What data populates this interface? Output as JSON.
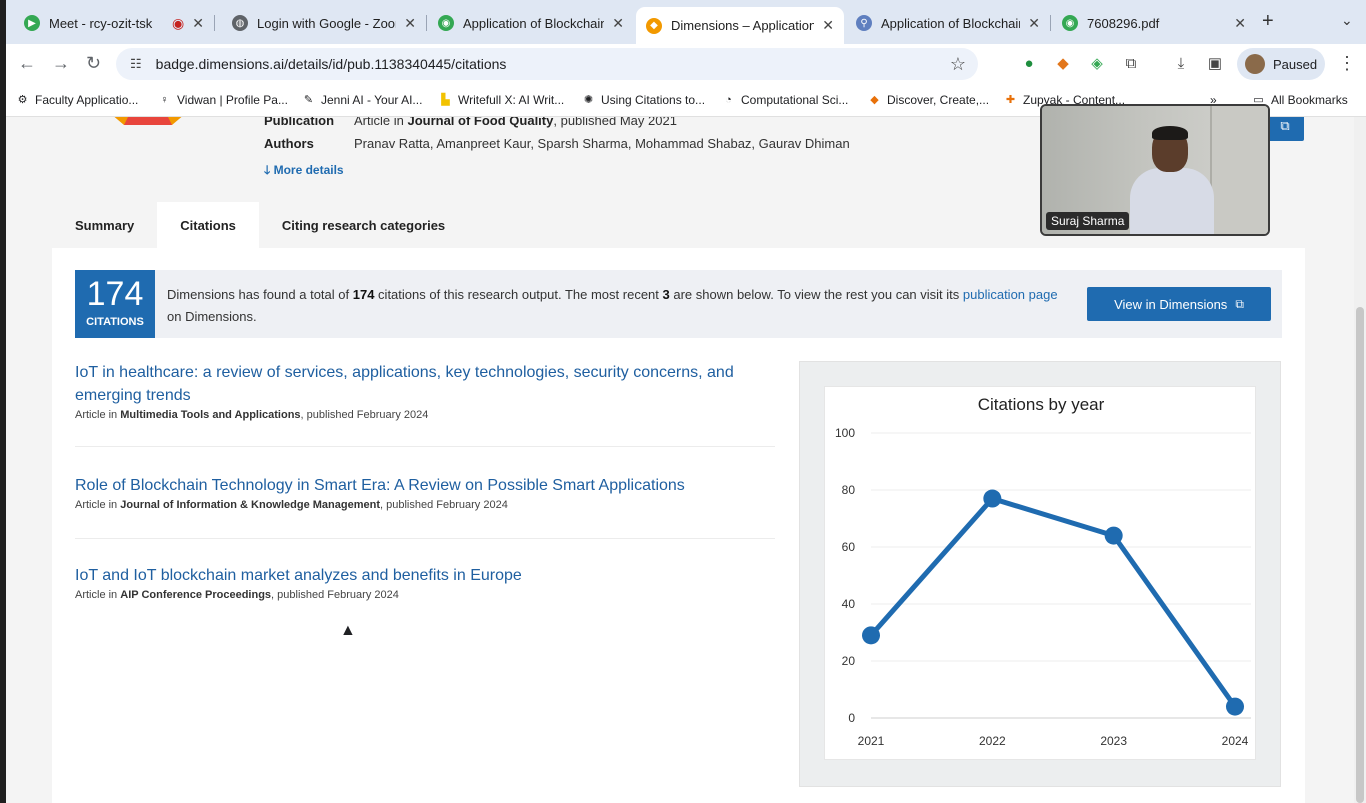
{
  "browser": {
    "tabs": [
      {
        "title": "Meet - rcy-ozit-tsk",
        "icon": "google-meet-icon",
        "active": false,
        "recording": true
      },
      {
        "title": "Login with Google - Zoom",
        "icon": "globe-icon",
        "active": false
      },
      {
        "title": "Application of Blockchain",
        "icon": "eye-icon",
        "active": false
      },
      {
        "title": "Dimensions – Application",
        "icon": "dimensions-icon",
        "active": true
      },
      {
        "title": "Application of Blockchain",
        "icon": "link-icon",
        "active": false
      },
      {
        "title": "7608296.pdf",
        "icon": "eye-icon",
        "active": false
      }
    ],
    "url": "badge.dimensions.ai/details/id/pub.1138340445/citations",
    "profile_label": "Paused",
    "bookmarks": [
      "Faculty Applicatio...",
      "Vidwan | Profile Pa...",
      "Jenni AI - Your AI...",
      "Writefull X: AI Writ...",
      "Using Citations to...",
      "Computational Sci...",
      "Discover, Create,...",
      "Zupyak - Content..."
    ],
    "all_bookmarks": "All Bookmarks"
  },
  "details": {
    "publication_label": "Publication",
    "publication_prefix": "Article in ",
    "journal": "Journal of Food Quality",
    "publication_suffix": ", published May 2021",
    "authors_label": "Authors",
    "authors": "Pranav Ratta, Amanpreet Kaur, Sparsh Sharma, Mohammad Shabaz, Gaurav Dhiman",
    "more_details": "More details"
  },
  "page_tabs": [
    "Summary",
    "Citations",
    "Citing research categories"
  ],
  "active_tab": "Citations",
  "notice": {
    "count": "174",
    "count_label": "CITATIONS",
    "msg_1": "Dimensions has found a total of ",
    "msg_count": "174",
    "msg_2": " citations of this research output. The most recent ",
    "msg_recent": "3",
    "msg_3": " are shown below. To view the rest you can visit its ",
    "msg_link": "publication page",
    "msg_4": " on Dimensions.",
    "button": "View in Dimensions"
  },
  "citations": [
    {
      "title": "IoT in healthcare: a review of services, applications, key technologies, security concerns, and emerging trends",
      "prefix": "Article in ",
      "journal": "Multimedia Tools and Applications",
      "suffix": ", published February 2024"
    },
    {
      "title": "Role of Blockchain Technology in Smart Era: A Review on Possible Smart Applications",
      "prefix": "Article in ",
      "journal": "Journal of Information & Knowledge Management",
      "suffix": ", published February 2024"
    },
    {
      "title": "IoT and IoT blockchain market analyzes and benefits in Europe",
      "prefix": "Article in ",
      "journal": "AIP Conference Proceedings",
      "suffix": ", published February 2024"
    }
  ],
  "video": {
    "participant": "Suraj Sharma"
  },
  "colors": {
    "accent": "#1f6bb0",
    "line": "#1f6bb0"
  },
  "chart_data": {
    "type": "line",
    "title": "Citations by year",
    "categories": [
      "2021",
      "2022",
      "2023",
      "2024"
    ],
    "values": [
      29,
      77,
      64,
      4
    ],
    "ylim": [
      0,
      100
    ],
    "yticks": [
      0,
      20,
      40,
      60,
      80,
      100
    ],
    "grid": true,
    "xlabel": "",
    "ylabel": ""
  }
}
